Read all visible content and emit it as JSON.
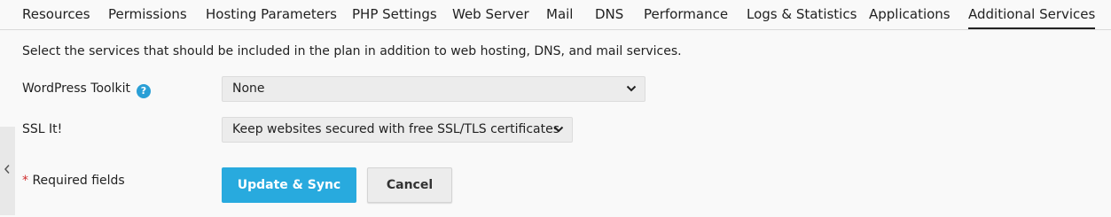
{
  "tabs": [
    {
      "label": "Resources"
    },
    {
      "label": "Permissions"
    },
    {
      "label": "Hosting Parameters"
    },
    {
      "label": "PHP Settings"
    },
    {
      "label": "Web Server"
    },
    {
      "label": "Mail"
    },
    {
      "label": "DNS"
    },
    {
      "label": "Performance"
    },
    {
      "label": "Logs & Statistics"
    },
    {
      "label": "Applications"
    },
    {
      "label": "Additional Services",
      "active": true
    }
  ],
  "intro_text": "Select the services that should be included in the plan in addition to web hosting, DNS, and mail services.",
  "fields": {
    "wordpress_toolkit": {
      "label": "WordPress Toolkit",
      "help_glyph": "?",
      "value": "None"
    },
    "ssl_it": {
      "label": "SSL It!",
      "value": "Keep websites secured with free SSL/TLS certificates"
    }
  },
  "required_note": {
    "star": "*",
    "text": " Required fields"
  },
  "buttons": {
    "update_sync": "Update & Sync",
    "cancel": "Cancel"
  },
  "colors": {
    "accent": "#28aade",
    "help_icon": "#2a9fd6",
    "required_star": "#d02e2e"
  }
}
